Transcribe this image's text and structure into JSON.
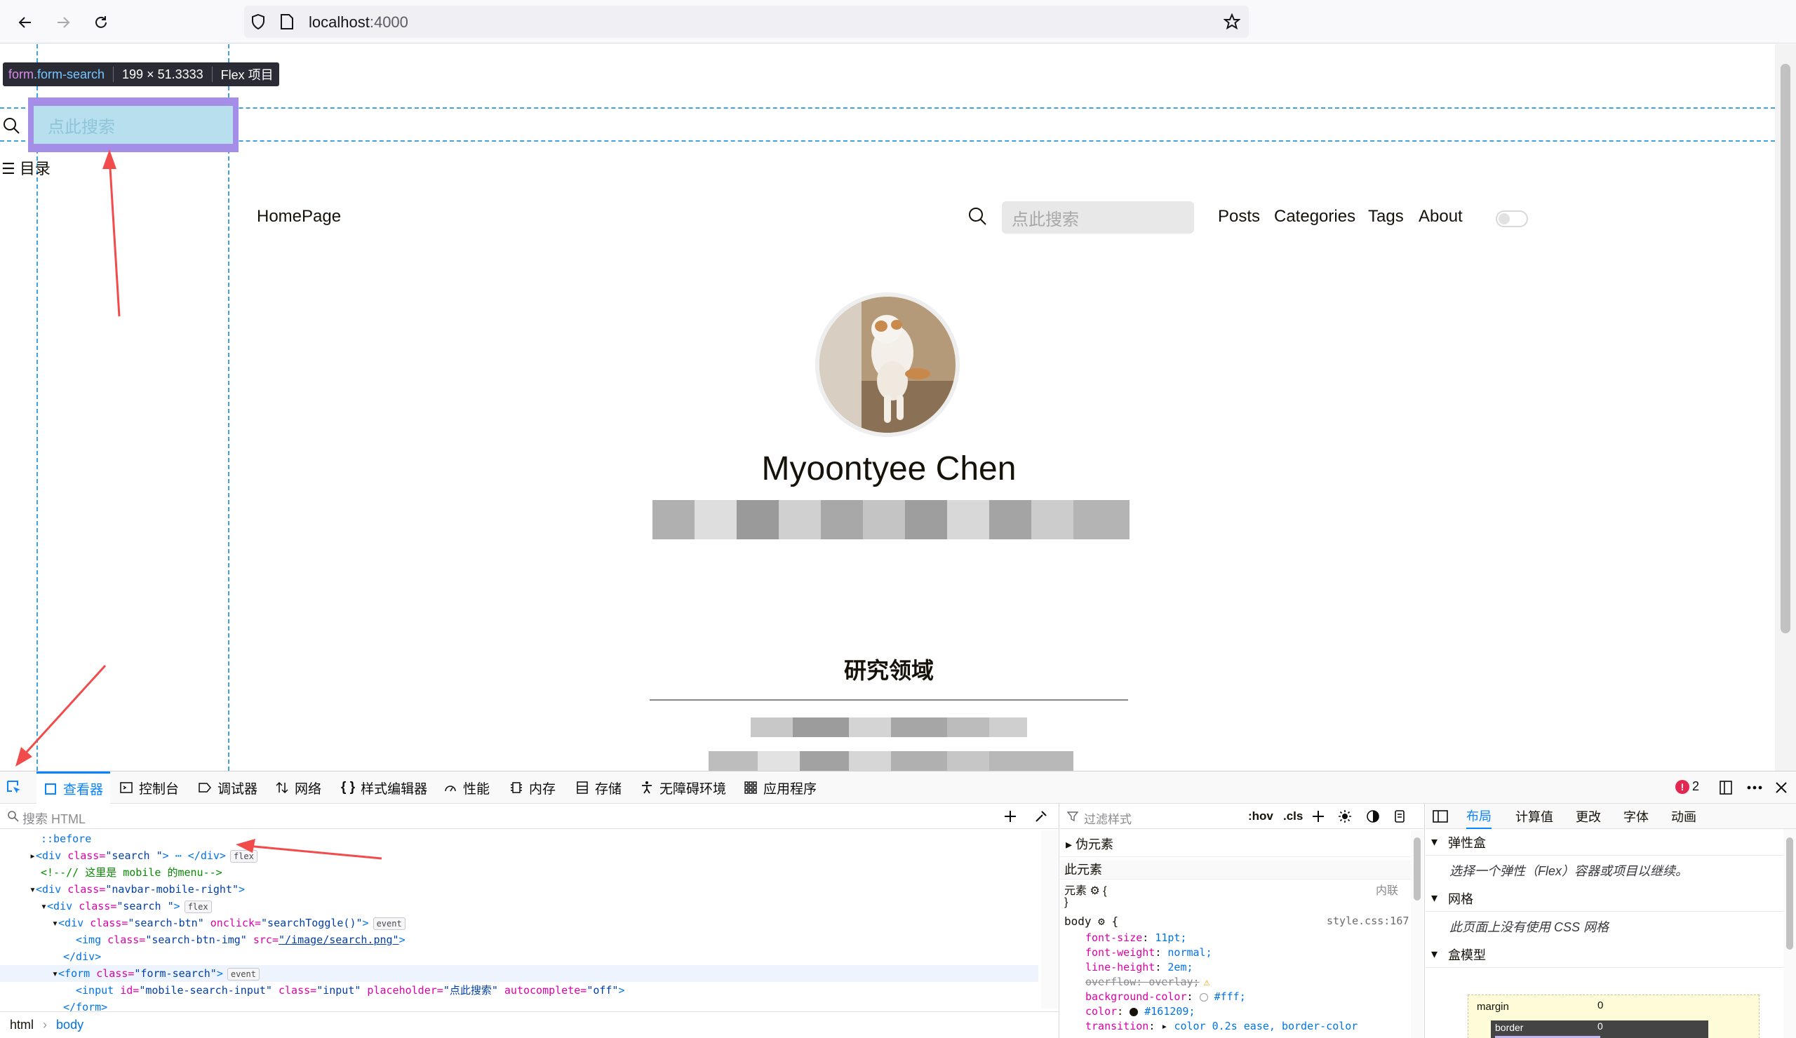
{
  "browser": {
    "url_host": "localhost",
    "url_port": ":4000"
  },
  "page_overlay": {
    "tooltip_tag": "form",
    "tooltip_class": ".form-search",
    "tooltip_size": "199 × 51.3333",
    "tooltip_type": "Flex 项目",
    "mobile_search_placeholder": "点此搜索",
    "mobile_menu_label": "☰ 目录"
  },
  "site": {
    "home": "HomePage",
    "search_placeholder": "点此搜索",
    "nav": [
      "Posts",
      "Categories",
      "Tags",
      "About"
    ],
    "author_name": "Myoontyee Chen",
    "section_title": "研究领域"
  },
  "devtools": {
    "tabs": [
      "查看器",
      "控制台",
      "调试器",
      "网络",
      "样式编辑器",
      "性能",
      "内存",
      "存储",
      "无障碍环境",
      "应用程序"
    ],
    "error_count": "2",
    "html_search_placeholder": "搜索 HTML",
    "markup": {
      "before": "::before",
      "l2_open": "<div ",
      "l2_class_attr": "class=",
      "l2_class_val": "\"search \"",
      "l2_close": "> ⋯ </div>",
      "badge_flex": "flex",
      "comment": "<!--// 这里是 mobile 的menu-->",
      "l4_open": "<div ",
      "l4_class_attr": "class=",
      "l4_class_val": "\"navbar-mobile-right\"",
      "l4_end": ">",
      "l5_open": "<div ",
      "l5_class_attr": "class=",
      "l5_class_val": "\"search \"",
      "l5_end": ">",
      "l6_open": "<div ",
      "l6_class_attr": "class=",
      "l6_class_val": "\"search-btn\"",
      "l6_onclick_attr": " onclick=",
      "l6_onclick_val": "\"searchToggle()\"",
      "l6_end": ">",
      "badge_event": "event",
      "l7_open": "<img ",
      "l7_class_attr": "class=",
      "l7_class_val": "\"search-btn-img\"",
      "l7_src_attr": " src=",
      "l7_src_val": "\"/image/search.png\"",
      "l7_end": ">",
      "l8": "</div>",
      "l9_open": "<form ",
      "l9_class_attr": "class=",
      "l9_class_val": "\"form-search\"",
      "l9_end": ">",
      "l10_open": "<input ",
      "l10_id_attr": "id=",
      "l10_id_val": "\"mobile-search-input\"",
      "l10_class_attr": " class=",
      "l10_class_val": "\"input\"",
      "l10_ph_attr": " placeholder=",
      "l10_ph_val": "\"点此搜索\"",
      "l10_ac_attr": " autocomplete=",
      "l10_ac_val": "\"off\"",
      "l10_end": ">",
      "l11": "</form>"
    },
    "breadcrumbs": [
      "html",
      "body"
    ],
    "rules": {
      "filter_placeholder": "过滤样式",
      "hov": ":hov",
      "cls": ".cls",
      "pseudo": "伪元素",
      "this_element": "此元素",
      "element_selector": "元素",
      "inline": "内联",
      "body_selector": "body",
      "body_source": "style.css:167",
      "open_brace": "{",
      "close_brace": "}",
      "decls": [
        {
          "name": "font-size",
          "value": "11pt;"
        },
        {
          "name": "font-weight",
          "value": "normal;"
        },
        {
          "name": "line-height",
          "value": "2em;"
        },
        {
          "name": "overflow",
          "value": "overlay;"
        },
        {
          "name": "background-color",
          "value": "#fff;"
        },
        {
          "name": "color",
          "value": "#161209;"
        },
        {
          "name": "transition",
          "value": "color 0.2s ease, border-color"
        }
      ]
    },
    "layout": {
      "tabs": [
        "布局",
        "计算值",
        "更改",
        "字体",
        "动画"
      ],
      "flexbox": "弹性盒",
      "flexbox_note": "选择一个弹性（Flex）容器或项目以继续。",
      "grid": "网格",
      "grid_note": "此页面上没有使用 CSS 网格",
      "boxmodel": "盒模型",
      "margin_label": "margin",
      "margin_value": "0",
      "border_label": "border",
      "border_value": "0"
    }
  }
}
